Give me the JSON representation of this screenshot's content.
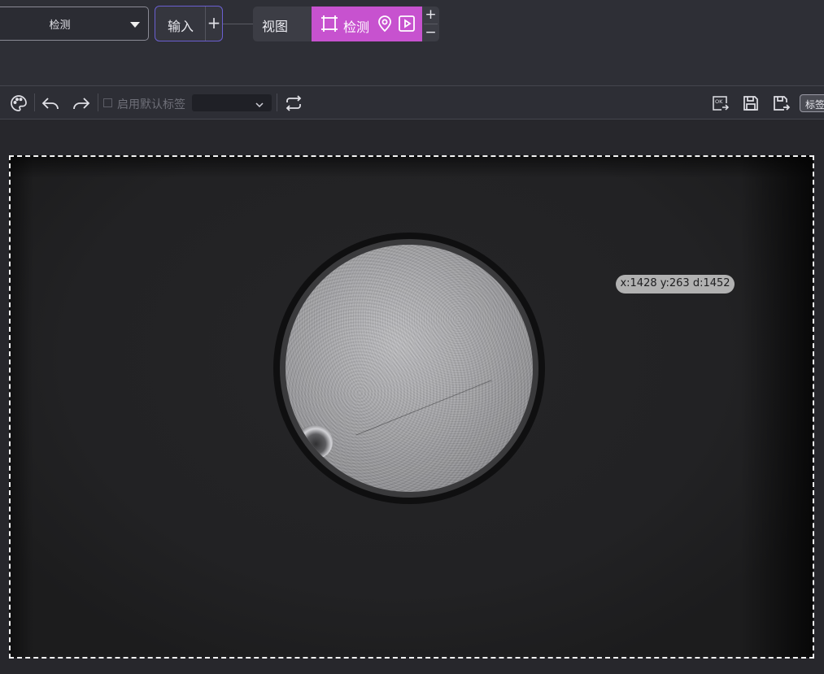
{
  "header": {
    "mode_select_value": "检测",
    "nodes": {
      "input_label": "输入",
      "input_add": "+",
      "view_label": "视图",
      "detect_label": "检测",
      "plus": "+",
      "minus": "−"
    }
  },
  "toolbar": {
    "default_label_checkbox": "启用默认标签",
    "default_label_value": "",
    "tag_button": "标签"
  },
  "canvas": {
    "coord_readout": "x:1428 y:263 d:1452"
  },
  "icons": {
    "detect_node": [
      "crop-frame-icon",
      "location-pin-icon",
      "play-icon"
    ],
    "toolbar": [
      "palette-icon",
      "undo-icon",
      "redo-icon",
      "chevron-down-icon",
      "repeat-icon",
      "ok-export-icon",
      "save-icon",
      "save-as-icon"
    ]
  },
  "colors": {
    "detect_node_bg": "#c752cf",
    "input_node_border": "#6a5fd0",
    "background": "#2a2a31"
  }
}
